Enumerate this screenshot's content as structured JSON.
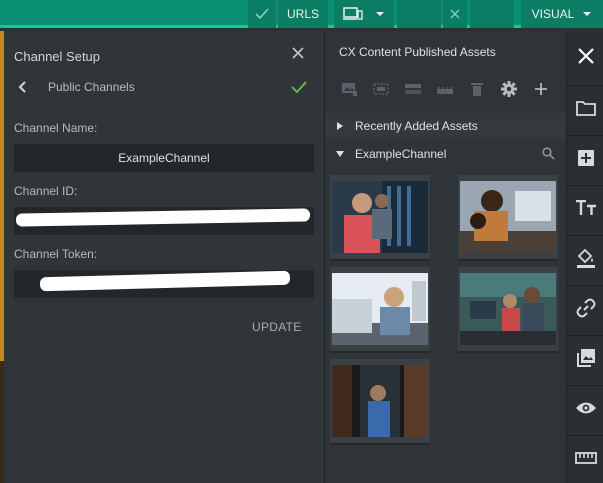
{
  "topbar": {
    "urls_label": "URLS",
    "visual_label": "VISUAL"
  },
  "channel_setup": {
    "title": "Channel Setup",
    "breadcrumb": "Public Channels",
    "name_label": "Channel Name:",
    "name_value": "ExampleChannel",
    "id_label": "Channel ID:",
    "token_label": "Channel Token:",
    "update_label": "UPDATE"
  },
  "assets": {
    "title": "CX Content Published Assets",
    "sections": [
      {
        "label": "Recently Added Assets",
        "expanded": false
      },
      {
        "label": "ExampleChannel",
        "expanded": true
      }
    ],
    "toolbar_icons": [
      "image-icon",
      "select-icon",
      "list-icon",
      "grid-icon",
      "trash-icon",
      "gear-icon",
      "plus-icon"
    ]
  },
  "sidebar_icons": [
    "folder-icon",
    "add-box-icon",
    "text-format-icon",
    "paint-bucket-icon",
    "link-icon",
    "image-gallery-icon",
    "eye-icon",
    "ruler-icon"
  ],
  "colors": {
    "topbar": "#0b8f72",
    "accent": "#17c79a",
    "check": "#6cc24a"
  }
}
